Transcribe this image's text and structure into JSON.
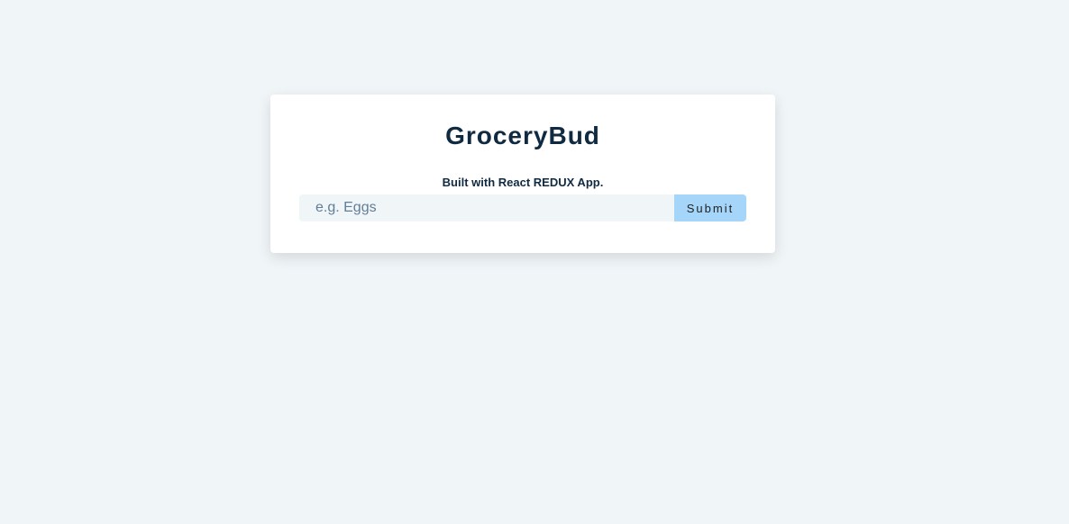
{
  "app": {
    "title": "GroceryBud",
    "subtitle": "Built with React REDUX App."
  },
  "form": {
    "input": {
      "value": "",
      "placeholder": "e.g. Eggs"
    },
    "submit_label": "Submit"
  },
  "colors": {
    "background": "#f0f5f8",
    "card": "#ffffff",
    "text_primary": "#102a42",
    "button": "#a5d5f8",
    "placeholder": "#617d98"
  }
}
